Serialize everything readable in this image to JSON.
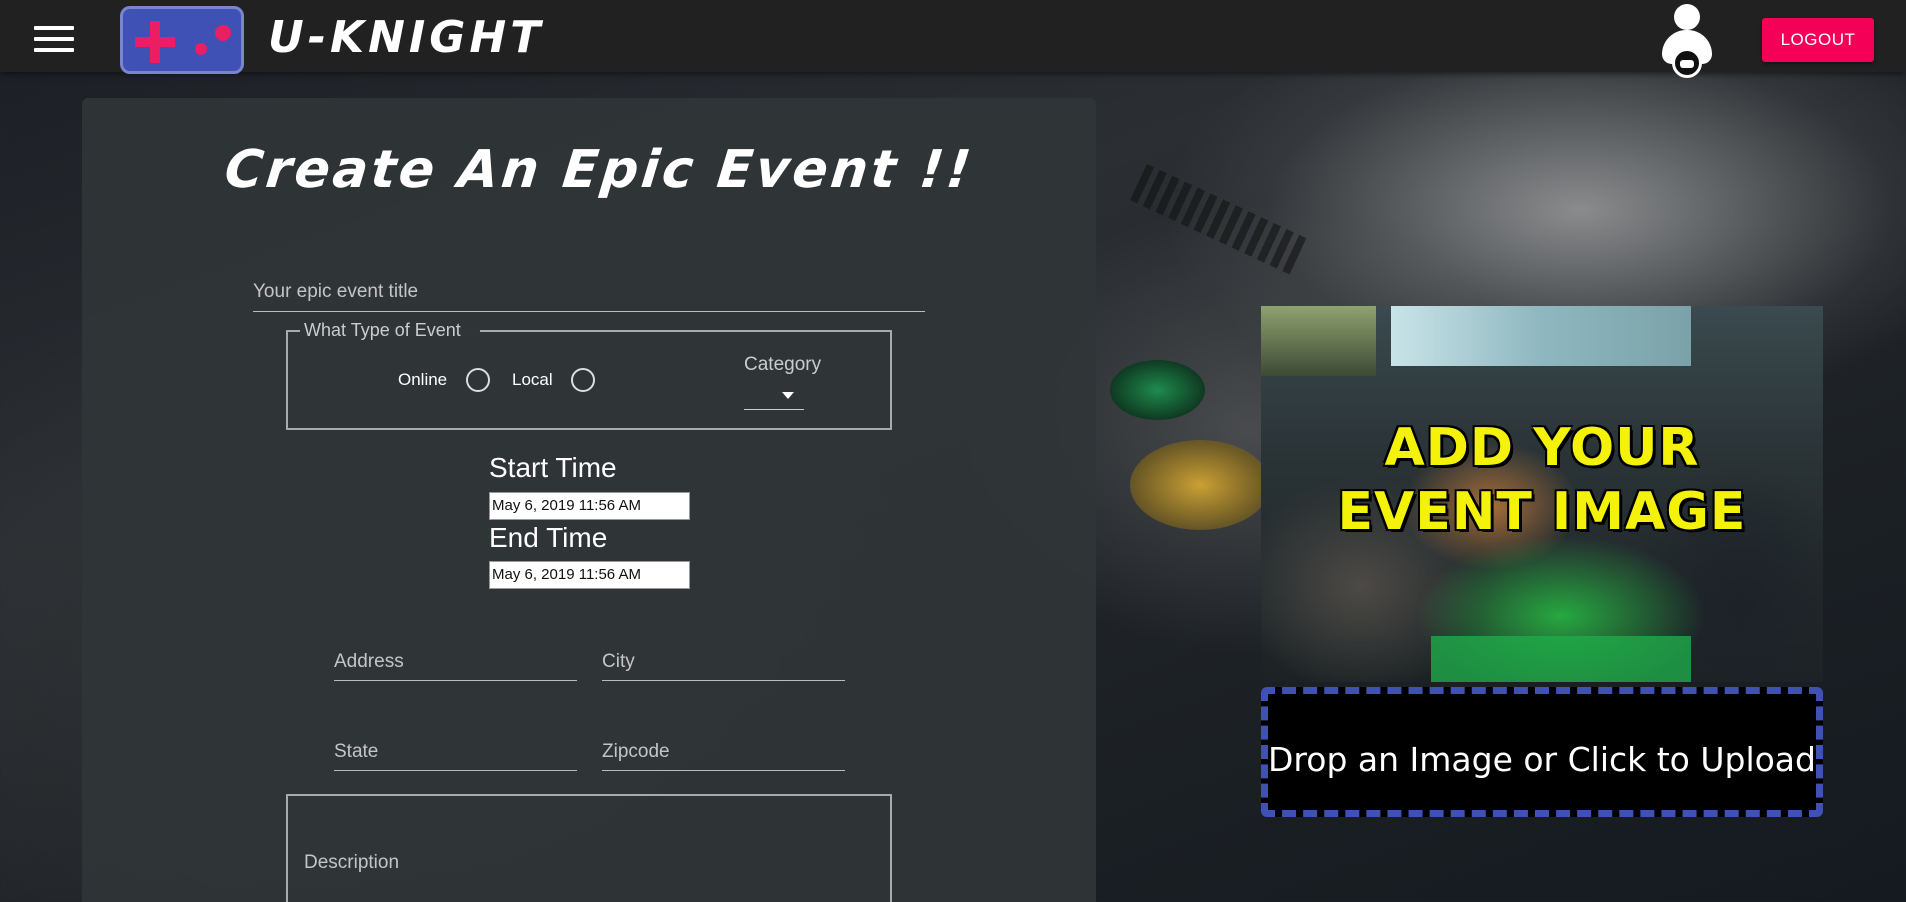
{
  "header": {
    "brand": "U-KNIGHT",
    "logout_label": "LOGOUT"
  },
  "form": {
    "page_title": "Create An Epic Event !!",
    "title_placeholder": "Your epic event title",
    "event_type": {
      "legend": "What Type of Event",
      "options": [
        "Online",
        "Local"
      ],
      "category_label": "Category"
    },
    "start_time": {
      "label": "Start Time",
      "value": "May 6, 2019 11:56 AM"
    },
    "end_time": {
      "label": "End Time",
      "value": "May 6, 2019 11:56 AM"
    },
    "address_placeholder": "Address",
    "city_placeholder": "City",
    "state_placeholder": "State",
    "zipcode_placeholder": "Zipcode",
    "description_placeholder": "Description"
  },
  "upload": {
    "image_overlay_line1": "ADD YOUR",
    "image_overlay_line2": "EVENT IMAGE",
    "dropzone_text": "Drop an Image or Click to Upload"
  },
  "icons": {
    "menu": "hamburger-menu-icon",
    "logo": "gamepad-logo-icon",
    "user": "user-gamepad-icon"
  },
  "colors": {
    "accent": "#f50057",
    "primary": "#3f51b5",
    "overlay_text": "#f5f20a",
    "topbar": "#212121"
  }
}
